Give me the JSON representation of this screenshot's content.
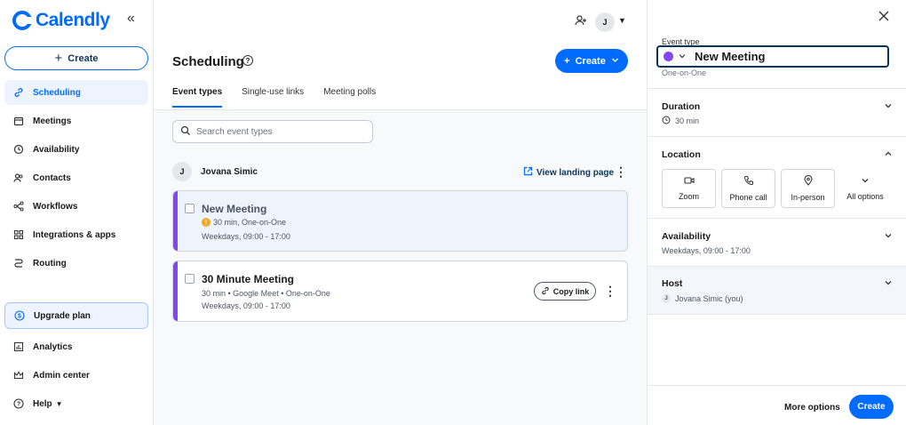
{
  "brand": {
    "name": "Calendly",
    "color": "#006bff",
    "accent_purple": "#8247f5"
  },
  "sidebar": {
    "collapse_icon": "double-chevron-left-icon",
    "create_label": "Create",
    "items": [
      {
        "label": "Scheduling",
        "icon": "link-icon",
        "active": true
      },
      {
        "label": "Meetings",
        "icon": "calendar-icon"
      },
      {
        "label": "Availability",
        "icon": "clock-icon"
      },
      {
        "label": "Contacts",
        "icon": "contacts-icon"
      },
      {
        "label": "Workflows",
        "icon": "workflow-icon"
      },
      {
        "label": "Integrations & apps",
        "icon": "grid-icon"
      },
      {
        "label": "Routing",
        "icon": "routing-icon"
      }
    ],
    "upgrade_label": "Upgrade plan",
    "bottom_items": [
      {
        "label": "Analytics",
        "icon": "chart-icon"
      },
      {
        "label": "Admin center",
        "icon": "crown-icon"
      },
      {
        "label": "Help",
        "icon": "help-icon"
      }
    ]
  },
  "header": {
    "avatar_initial": "J"
  },
  "main": {
    "title": "Scheduling",
    "create_label": "Create",
    "tabs": [
      {
        "label": "Event types",
        "active": true
      },
      {
        "label": "Single-use links"
      },
      {
        "label": "Meeting polls"
      }
    ],
    "search_placeholder": "Search event types",
    "owner": {
      "initial": "J",
      "name": "Jovana Simic"
    },
    "landing_label": "View landing page",
    "cards": [
      {
        "title": "New Meeting",
        "details": "30 min, One-on-One",
        "hours": "Weekdays, 09:00 - 17:00",
        "warning": true
      },
      {
        "title": "30 Minute Meeting",
        "details": "30 min • Google Meet • One-on-One",
        "hours": "Weekdays, 09:00 - 17:00",
        "copy_label": "Copy link"
      }
    ]
  },
  "panel": {
    "event_type_label": "Event type",
    "event_name": "New Meeting",
    "event_kind": "One-on-One",
    "duration": {
      "title": "Duration",
      "value": "30 min"
    },
    "location": {
      "title": "Location",
      "options": [
        {
          "label": "Zoom",
          "icon": "video-icon"
        },
        {
          "label": "Phone call",
          "icon": "phone-icon"
        },
        {
          "label": "In-person",
          "icon": "pin-icon"
        },
        {
          "label": "All options",
          "icon": "chevron-down-icon"
        }
      ]
    },
    "availability": {
      "title": "Availability",
      "value": "Weekdays, 09:00 - 17:00"
    },
    "host": {
      "title": "Host",
      "initial": "J",
      "value": "Jovana Simic (you)"
    },
    "more_options_label": "More options",
    "create_label": "Create"
  }
}
